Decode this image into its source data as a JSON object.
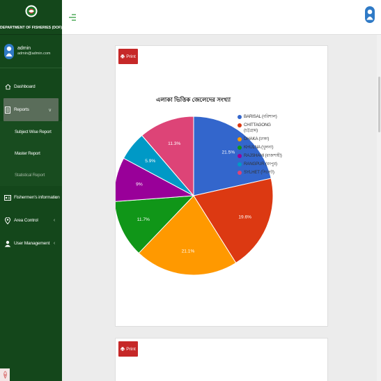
{
  "sidebar": {
    "brand": "DEPARTMENT OF FISHERIES (DOF)",
    "user_name": "admin",
    "user_email": "admin@admin.com",
    "items": [
      {
        "label": "Dashboard",
        "icon": "home-icon"
      },
      {
        "label": "Reports",
        "icon": "document-icon",
        "chevron": "∨"
      },
      {
        "label": "Fishermen's information",
        "icon": "id-card-icon",
        "chevron": "‹"
      },
      {
        "label": "Area Control",
        "icon": "location-pin-icon",
        "chevron": "‹"
      },
      {
        "label": "User Management",
        "icon": "users-icon",
        "chevron": "‹"
      }
    ],
    "report_subitems": [
      "Subject Wise Report",
      "Master Report",
      "Statistical Report"
    ]
  },
  "buttons": {
    "print": "Print"
  },
  "chart_data": {
    "type": "pie",
    "title": "এলাকা ভিত্তিক জেলেদের সংখ্যা",
    "legend_position": "right",
    "slices": [
      {
        "label": "BARISAL (বরিশাল)",
        "value": 21.5,
        "text": "21.5%",
        "color": "#3366cc"
      },
      {
        "label": "CHITTAGONG (চট্টগ্রাম)",
        "value": 19.6,
        "text": "19.6%",
        "color": "#dc3912"
      },
      {
        "label": "DHAKA (ঢাকা)",
        "value": 21.1,
        "text": "21.1%",
        "color": "#ff9900"
      },
      {
        "label": "KHULNA (খুলনা)",
        "value": 11.7,
        "text": "11.7%",
        "color": "#109618"
      },
      {
        "label": "RAJSHAHI (রাজশাহী)",
        "value": 9,
        "text": "9%",
        "color": "#990099"
      },
      {
        "label": "RANGPUR (রংপুর)",
        "value": 5.9,
        "text": "5.9%",
        "color": "#0099c6"
      },
      {
        "label": "SYLHET (সিলেট)",
        "value": 11.3,
        "text": "11.3%",
        "color": "#dd4477"
      }
    ]
  }
}
